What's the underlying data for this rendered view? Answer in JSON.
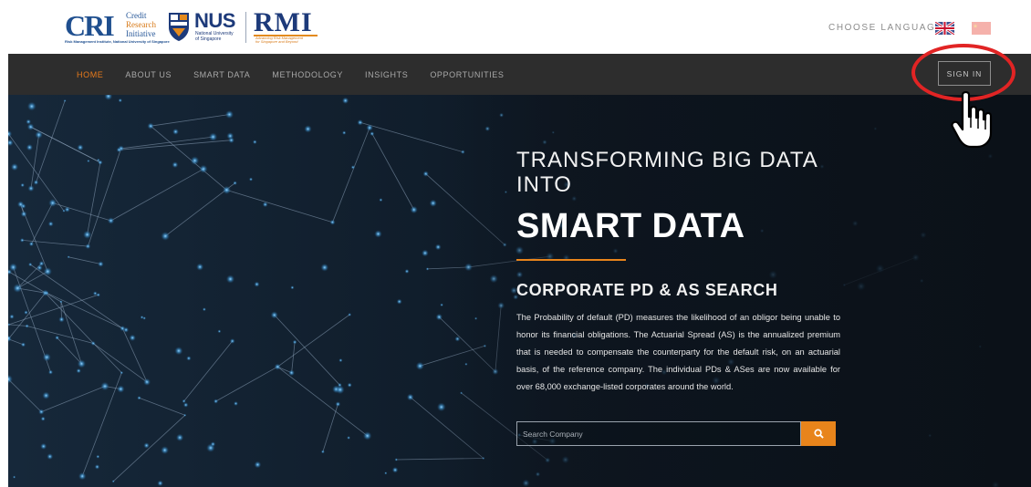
{
  "header": {
    "cri_logo": {
      "mark": "CRI",
      "line1": "Credit",
      "line2": "Research",
      "line3": "Initiative",
      "footer": "Risk Management Institute, National University of Singapore"
    },
    "nus_logo": {
      "mark": "NUS",
      "sub1": "National University",
      "sub2": "of Singapore"
    },
    "rmi_logo": {
      "mark": "RMI",
      "tag1": "Advancing Risk Management",
      "tag2": "for Singapore and Beyond"
    },
    "choose_language": "CHOOSE LANGUAGE",
    "flags": [
      "uk-flag-icon",
      "china-flag-icon"
    ]
  },
  "nav": {
    "items": [
      {
        "label": "HOME",
        "active": true
      },
      {
        "label": "ABOUT US",
        "active": false
      },
      {
        "label": "SMART DATA",
        "active": false
      },
      {
        "label": "METHODOLOGY",
        "active": false
      },
      {
        "label": "INSIGHTS",
        "active": false
      },
      {
        "label": "OPPORTUNITIES",
        "active": false
      }
    ],
    "sign_in": "SIGN IN"
  },
  "hero": {
    "line1": "TRANSFORMING BIG DATA INTO",
    "line2": "SMART DATA",
    "section_title": "CORPORATE PD & AS SEARCH",
    "description": "The Probability of default (PD) measures the likelihood of an obligor being unable to honor its financial obligations. The Actuarial Spread (AS) is the annualized premium that is needed to compensate the counterparty for the default risk, on an actuarial basis, of the reference company. The individual PDs & ASes are now available for over 68,000 exchange-listed corporates around the world.",
    "search": {
      "placeholder": "Search Company",
      "value": ""
    }
  },
  "colors": {
    "accent": "#e8841b",
    "nav_bg": "#2d2d2d",
    "annotation": "#e12424",
    "brand_blue": "#1d3a7a"
  }
}
